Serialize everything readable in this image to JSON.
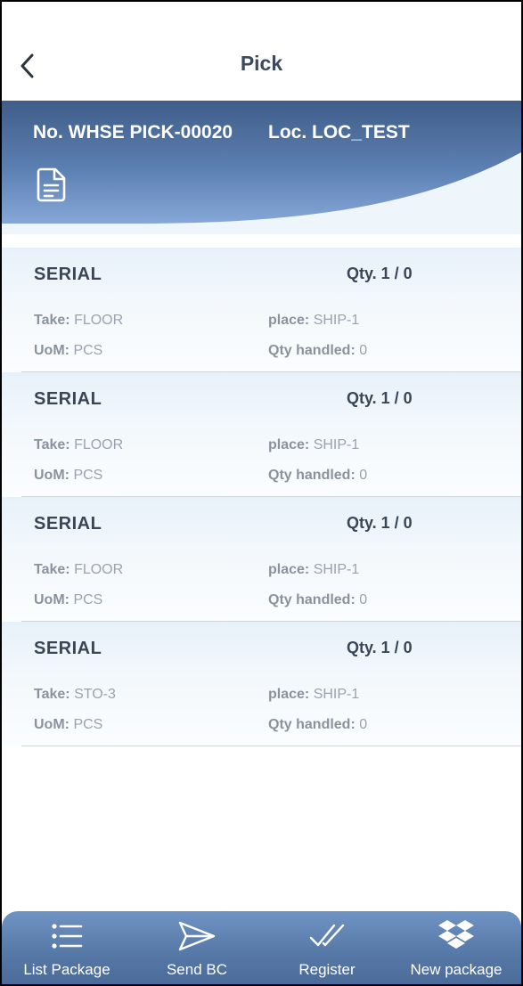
{
  "appbar": {
    "title": "Pick"
  },
  "header": {
    "doc_no": "No. WHSE PICK-00020",
    "location": "Loc. LOC_TEST"
  },
  "icons": {
    "back": "chevron-left-icon",
    "document": "document-icon",
    "list_package": "list-icon",
    "send_bc": "send-icon",
    "register": "double-check-icon",
    "new_package": "dropbox-icon"
  },
  "items": [
    {
      "name": "SERIAL",
      "qty": "Qty. 1 / 0",
      "take_label": "Take:",
      "take": "FLOOR",
      "place_label": "place:",
      "place": "SHIP-1",
      "uom_label": "UoM:",
      "uom": "PCS",
      "handled_label": "Qty handled:",
      "handled": "0"
    },
    {
      "name": "SERIAL",
      "qty": "Qty. 1 / 0",
      "take_label": "Take:",
      "take": "FLOOR",
      "place_label": "place:",
      "place": "SHIP-1",
      "uom_label": "UoM:",
      "uom": "PCS",
      "handled_label": "Qty handled:",
      "handled": "0"
    },
    {
      "name": "SERIAL",
      "qty": "Qty. 1 / 0",
      "take_label": "Take:",
      "take": "FLOOR",
      "place_label": "place:",
      "place": "SHIP-1",
      "uom_label": "UoM:",
      "uom": "PCS",
      "handled_label": "Qty handled:",
      "handled": "0"
    },
    {
      "name": "SERIAL",
      "qty": "Qty. 1 / 0",
      "take_label": "Take:",
      "take": "STO-3",
      "place_label": "place:",
      "place": "SHIP-1",
      "uom_label": "UoM:",
      "uom": "PCS",
      "handled_label": "Qty handled:",
      "handled": "0"
    }
  ],
  "bottom_nav": [
    {
      "label": "List Package"
    },
    {
      "label": "Send BC"
    },
    {
      "label": "Register"
    },
    {
      "label": "New package"
    }
  ],
  "colors": {
    "banner_dark": "#3f5d88",
    "banner_light": "#7c9fd0",
    "nav": "#5a7cab",
    "text_dark": "#3a4656",
    "text_muted": "#9aa3ad"
  }
}
